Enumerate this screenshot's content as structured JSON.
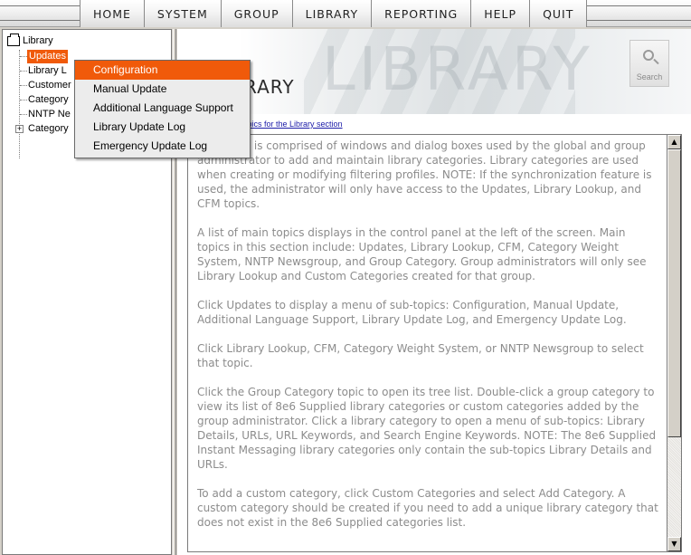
{
  "menubar": {
    "items": [
      "HOME",
      "SYSTEM",
      "GROUP",
      "LIBRARY",
      "REPORTING",
      "HELP",
      "QUIT"
    ]
  },
  "tree": {
    "root": "Library",
    "items": [
      {
        "label": "Updates",
        "selected": true
      },
      {
        "label": "Library L",
        "selected": false
      },
      {
        "label": "Customer",
        "selected": false
      },
      {
        "label": "Category",
        "selected": false
      },
      {
        "label": "NNTP Ne",
        "selected": false
      },
      {
        "label": "Category",
        "selected": false,
        "expandable": true
      }
    ]
  },
  "banner": {
    "watermark": "LIBRARY",
    "title": "RARY",
    "search_label": "Search"
  },
  "main": {
    "topics_link": "Topics for the Library section",
    "paragraphs": [
      "ry section is comprised of windows and dialog boxes used by the global and group administrator to add and maintain library categories. Library categories are used when creating or modifying filtering profiles. NOTE: If the synchronization feature is used, the administrator will only have access to the Updates, Library Lookup, and CFM topics.",
      "A list of main topics displays in the control panel at the left of the screen. Main topics in this section include: Updates, Library Lookup, CFM, Category Weight System, NNTP Newsgroup, and Group Category. Group administrators will only see Library Lookup and Custom Categories created for that group.",
      "Click Updates to display a menu of sub-topics: Configuration, Manual Update, Additional Language Support, Library Update Log, and Emergency Update Log.",
      "Click Library Lookup, CFM, Category Weight System, or NNTP Newsgroup to select that topic.",
      "Click the Group Category topic to open its tree list. Double-click a group category to view its list of 8e6 Supplied library categories or custom categories added by the group administrator. Click a library category to open a menu of sub-topics: Library Details, URLs, URL Keywords, and Search Engine Keywords. NOTE: The 8e6 Supplied Instant Messaging library categories only contain the sub-topics Library Details and URLs.",
      "To add a custom category, click Custom Categories and select Add Category. A custom category should be created if you need to add a unique library category that does not exist in the 8e6 Supplied categories list."
    ]
  },
  "popup": {
    "items": [
      {
        "label": "Configuration",
        "active": true
      },
      {
        "label": "Manual Update",
        "active": false
      },
      {
        "label": "Additional Language Support",
        "active": false
      },
      {
        "label": "Library Update Log",
        "active": false
      },
      {
        "label": "Emergency Update Log",
        "active": false
      }
    ]
  },
  "colors": {
    "accent": "#f05a0a",
    "link": "#1a1aa8",
    "body_text": "#8c8c8c"
  }
}
